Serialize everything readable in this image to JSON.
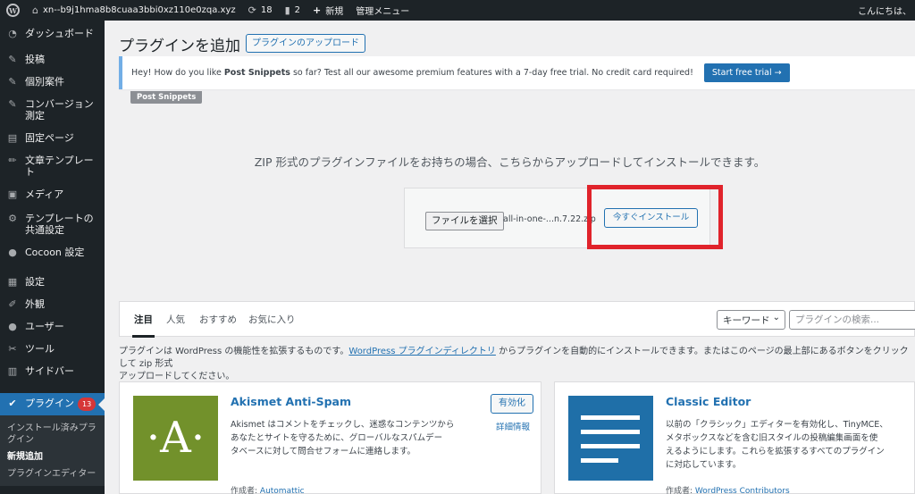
{
  "admin_bar": {
    "site_name": "xn--b9j1hma8b8cuaa3bbi0xz110e0zqa.xyz",
    "updates_count": "18",
    "comments_count": "2",
    "new_label": "新規",
    "menu_label": "管理メニュー",
    "greeting": "こんにちは、"
  },
  "sidebar": {
    "items": [
      {
        "label": "ダッシュボード",
        "icon": "dashboard-icon"
      },
      {
        "label": "投稿",
        "icon": "pin-icon"
      },
      {
        "label": "個別案件",
        "icon": "pin-icon"
      },
      {
        "label": "コンバージョン測定",
        "icon": "pin-icon"
      },
      {
        "label": "固定ページ",
        "icon": "page-icon"
      },
      {
        "label": "文章テンプレート",
        "icon": "pencil-icon"
      },
      {
        "label": "メディア",
        "icon": "media-icon"
      },
      {
        "label": "テンプレートの共通設定",
        "icon": "gear-icon"
      },
      {
        "label": "Cocoon 設定",
        "icon": "circle-icon"
      },
      {
        "label": "設定",
        "icon": "settings-icon"
      },
      {
        "label": "外観",
        "icon": "brush-icon"
      },
      {
        "label": "ユーザー",
        "icon": "user-icon"
      },
      {
        "label": "ツール",
        "icon": "wrench-icon"
      },
      {
        "label": "サイドバー",
        "icon": "sidebar-icon"
      }
    ],
    "current": {
      "label": "プラグイン",
      "badge": "13",
      "icon": "plugin-icon"
    },
    "submenu": [
      {
        "label": "インストール済みプラグイン"
      },
      {
        "label": "新規追加"
      },
      {
        "label": "プラグインエディター"
      }
    ]
  },
  "page": {
    "title": "プラグインを追加",
    "upload_button": "プラグインのアップロード"
  },
  "notice": {
    "text_before": "Hey! How do you like ",
    "product": "Post Snippets",
    "text_after": " so far? Test all our awesome premium features with a 7-day free trial. No credit card required!",
    "trial_button": "Start free trial",
    "tag": "Post Snippets"
  },
  "upload": {
    "description": "ZIP 形式のプラグインファイルをお持ちの場合、こちらからアップロードしてインストールできます。",
    "file_button": "ファイルを選択",
    "file_name": "all-in-one-...n.7.22.zip",
    "install_button": "今すぐインストール"
  },
  "filters": {
    "tabs": [
      "注目",
      "人気",
      "おすすめ",
      "お気に入り"
    ],
    "select_value": "キーワード",
    "search_placeholder": "プラグインの検索..."
  },
  "help": {
    "part1": "プラグインは WordPress の機能性を拡張するものです。",
    "link": "WordPress プラグインディレクトリ",
    "part2": " からプラグインを自動的にインストールできます。またはこのページの最上部にあるボタンをクリックして zip 形式",
    "part3": "アップロードしてください。"
  },
  "cards": [
    {
      "title": "Akismet Anti-Spam",
      "desc1": "Akismet はコメントをチェックし、迷惑なコンテンツから",
      "desc2": "あなたとサイトを守るために、グローバルなスパムデー",
      "desc3": "タベースに対して問合せフォームに連絡します。",
      "author_label": "作成者: ",
      "author": "Automattic",
      "action": "有効化",
      "details": "詳細情報",
      "thumb_text": "·A·"
    },
    {
      "title": "Classic Editor",
      "desc1": "以前の「クラシック」エディターを有効化し、TinyMCE、",
      "desc2": "メタボックスなどを含む旧スタイルの投稿編集画面を使",
      "desc3": "えるようにします。これらを拡張するすべてのプラグイン",
      "desc4": "に対応しています。",
      "author_label": "作成者: ",
      "author": "WordPress Contributors"
    }
  ],
  "colors": {
    "admin_bg": "#1d2327",
    "accent": "#2271b1",
    "highlight": "#e0232b",
    "akismet": "#72912b"
  }
}
